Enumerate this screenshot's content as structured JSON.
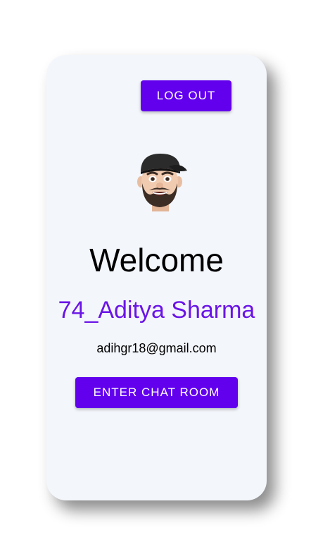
{
  "header": {
    "logout_label": "LOG OUT"
  },
  "profile": {
    "welcome": "Welcome",
    "username": "74_Aditya Sharma",
    "email": "adihgr18@gmail.com",
    "avatar": "memoji-avatar"
  },
  "actions": {
    "enter_chat_label": "ENTER CHAT ROOM"
  },
  "colors": {
    "accent": "#6200ee",
    "username": "#6a14e6",
    "card_background": "#f3f6fb"
  }
}
